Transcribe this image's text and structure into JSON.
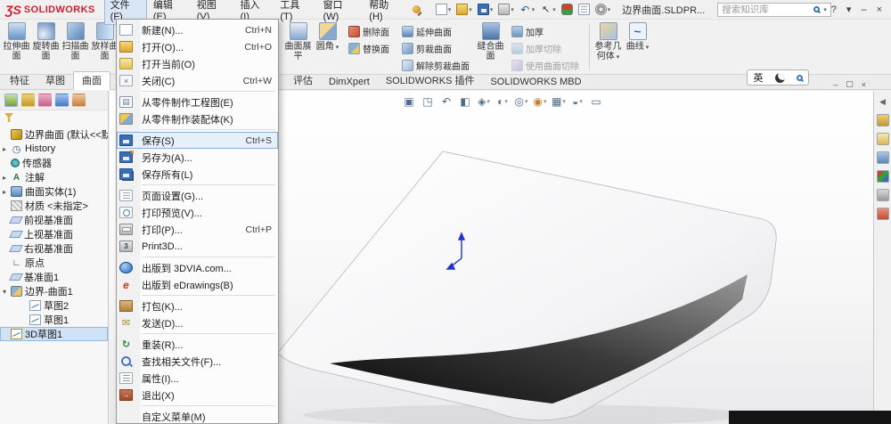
{
  "titlebar": {
    "logo_glyph": "ƷS",
    "logo_text": "SOLIDWORKS",
    "menus": [
      {
        "label": "文件(F)",
        "active": true
      },
      {
        "label": "编辑(E)"
      },
      {
        "label": "视图(V)"
      },
      {
        "label": "插入(I)"
      },
      {
        "label": "工具(T)"
      },
      {
        "label": "窗口(W)"
      },
      {
        "label": "帮助(H)"
      }
    ],
    "tools": [
      {
        "icon": "new",
        "dropdown": true
      },
      {
        "icon": "open",
        "dropdown": true
      },
      {
        "icon": "save",
        "dropdown": true
      },
      {
        "icon": "print",
        "dropdown": true
      },
      {
        "icon": "undo",
        "dropdown": true
      },
      {
        "icon": "select",
        "dropdown": true
      },
      {
        "icon": "rebuild"
      },
      {
        "icon": "file-properties"
      },
      {
        "icon": "options",
        "dropdown": true
      }
    ],
    "document_title": "边界曲面.SLDPR...",
    "search_placeholder": "搜索知识库",
    "window_controls": [
      {
        "icon": "help",
        "glyph": "?"
      },
      {
        "icon": "dropdown",
        "glyph": "▾"
      },
      {
        "icon": "minimize",
        "glyph": "–"
      },
      {
        "icon": "close",
        "glyph": "×"
      }
    ]
  },
  "file_menu": {
    "items": [
      {
        "icon": "new",
        "label": "新建(N)...",
        "shortcut": "Ctrl+N"
      },
      {
        "icon": "open",
        "label": "打开(O)...",
        "shortcut": "Ctrl+O"
      },
      {
        "icon": "open-current",
        "label": "打开当前(O)"
      },
      {
        "icon": "close",
        "label": "关闭(C)",
        "shortcut": "Ctrl+W"
      },
      {
        "type": "separator"
      },
      {
        "icon": "make-drawing",
        "label": "从零件制作工程图(E)"
      },
      {
        "icon": "make-assembly",
        "label": "从零件制作装配体(K)"
      },
      {
        "type": "separator"
      },
      {
        "icon": "save",
        "label": "保存(S)",
        "shortcut": "Ctrl+S",
        "selected": true
      },
      {
        "icon": "save-as",
        "label": "另存为(A)..."
      },
      {
        "icon": "save-all",
        "label": "保存所有(L)"
      },
      {
        "type": "separator"
      },
      {
        "icon": "page-setup",
        "label": "页面设置(G)..."
      },
      {
        "icon": "print-preview",
        "label": "打印预览(V)..."
      },
      {
        "icon": "print",
        "label": "打印(P)...",
        "shortcut": "Ctrl+P"
      },
      {
        "icon": "print3d",
        "label": "Print3D..."
      },
      {
        "type": "separator"
      },
      {
        "icon": "3dvia",
        "label": "出版到 3DVIA.com..."
      },
      {
        "icon": "edrawings",
        "label": "出版到 eDrawings(B)"
      },
      {
        "type": "separator"
      },
      {
        "icon": "pack",
        "label": "打包(K)..."
      },
      {
        "icon": "send",
        "label": "发送(D)..."
      },
      {
        "type": "separator"
      },
      {
        "icon": "reload",
        "label": "重装(R)..."
      },
      {
        "icon": "find-references",
        "label": "查找相关文件(F)..."
      },
      {
        "icon": "properties",
        "label": "属性(I)..."
      },
      {
        "icon": "exit",
        "label": "退出(X)"
      },
      {
        "type": "separator"
      },
      {
        "icon": "none",
        "label": "自定义菜单(M)"
      }
    ]
  },
  "ribbon": {
    "big_left": [
      {
        "icon": "extrude-surface",
        "label": "拉伸曲面"
      },
      {
        "icon": "revolve-surface",
        "label": "旋转曲面"
      },
      {
        "icon": "sweep-surface",
        "label": "扫描曲面"
      },
      {
        "icon": "loft-surface",
        "label": "放样曲面"
      }
    ],
    "big_mid": [
      {
        "icon": "flatten-surface",
        "label": "曲面展平"
      },
      {
        "icon": "fillet",
        "label": "圆角",
        "dropdown": true
      }
    ],
    "stack1": [
      {
        "icon": "delete-face",
        "label": "删除面"
      },
      {
        "icon": "replace-face",
        "label": "替换面"
      }
    ],
    "stack2": [
      {
        "icon": "extend-surface",
        "label": "延伸曲面"
      },
      {
        "icon": "trim-surface",
        "label": "剪裁曲面"
      },
      {
        "icon": "untrim-surface",
        "label": "解除剪裁曲面"
      }
    ],
    "big_knit": [
      {
        "icon": "knit-surface",
        "label": "缝合曲面"
      }
    ],
    "stack3": [
      {
        "icon": "thicken",
        "label": "加厚"
      },
      {
        "icon": "thicken-cut",
        "label": "加厚切除",
        "disabled": true
      },
      {
        "icon": "cut-with-surface",
        "label": "使用曲面切除",
        "disabled": true
      }
    ],
    "big_right": [
      {
        "icon": "reference-geometry",
        "label": "参考几何体",
        "dropdown": true
      },
      {
        "icon": "curves",
        "label": "曲线",
        "dropdown": true
      }
    ]
  },
  "tabs": {
    "items": [
      {
        "label": "特征"
      },
      {
        "label": "草图"
      },
      {
        "label": "曲面",
        "active": true
      },
      {
        "label": "评估"
      },
      {
        "label": "DimXpert"
      },
      {
        "label": "SOLIDWORKS 插件"
      },
      {
        "label": "SOLIDWORKS MBD"
      }
    ],
    "window_buttons": [
      {
        "icon": "minimize",
        "glyph": "–"
      },
      {
        "icon": "restore",
        "glyph": "▢"
      },
      {
        "icon": "close",
        "glyph": "×"
      }
    ]
  },
  "feature_tree": {
    "manager_tabs": [
      {
        "icon": "feature-manager",
        "active": true
      },
      {
        "icon": "property-manager"
      },
      {
        "icon": "configuration-manager"
      },
      {
        "icon": "dimxpert-manager"
      },
      {
        "icon": "display-manager"
      }
    ],
    "items": [
      {
        "icon": "part",
        "label": "边界曲面 (默认<<默认>_显"
      },
      {
        "icon": "history",
        "label": "History",
        "caret": "right"
      },
      {
        "icon": "sensors",
        "label": "传感器"
      },
      {
        "icon": "annotations",
        "label": "注解",
        "caret": "right"
      },
      {
        "icon": "surface-bodies",
        "label": "曲面实体(1)",
        "caret": "right"
      },
      {
        "icon": "material",
        "label": "材质 <未指定>"
      },
      {
        "icon": "plane",
        "label": "前视基准面"
      },
      {
        "icon": "plane",
        "label": "上视基准面"
      },
      {
        "icon": "plane",
        "label": "右视基准面"
      },
      {
        "icon": "origin",
        "label": "原点"
      },
      {
        "icon": "plane",
        "label": "基准面1"
      },
      {
        "icon": "boundary-surface",
        "label": "边界-曲面1",
        "caret": "down"
      },
      {
        "icon": "sketch",
        "label": "草图2",
        "indent": true
      },
      {
        "icon": "sketch",
        "label": "草图1",
        "indent": true
      },
      {
        "icon": "sketch3d",
        "label": "3D草图1",
        "selected": true
      }
    ]
  },
  "viewport": {
    "hud": [
      {
        "icon": "zoom-fit"
      },
      {
        "icon": "zoom-area"
      },
      {
        "icon": "previous-view"
      },
      {
        "icon": "section-view"
      },
      {
        "icon": "view-orientation",
        "dropdown": true
      },
      {
        "icon": "display-style",
        "dropdown": true
      },
      {
        "icon": "hide-show-items",
        "dropdown": true
      },
      {
        "icon": "edit-appearance",
        "dropdown": true
      },
      {
        "icon": "apply-scene",
        "dropdown": true
      },
      {
        "icon": "view-settings",
        "dropdown": true
      },
      {
        "icon": "fullscreen-monitor"
      }
    ],
    "ime": {
      "text": "英"
    }
  },
  "task_pane": {
    "icons": [
      {
        "icon": "expand-arrow"
      },
      {
        "icon": "design-library"
      },
      {
        "icon": "file-explorer"
      },
      {
        "icon": "view-palette"
      },
      {
        "icon": "appearances"
      },
      {
        "icon": "custom-properties"
      },
      {
        "icon": "solidworks-resources"
      }
    ]
  },
  "colors": {
    "brand_red": "#cf1f2e",
    "accent_blue": "#3a78c0",
    "selection_blue": "#cfe2f7"
  }
}
